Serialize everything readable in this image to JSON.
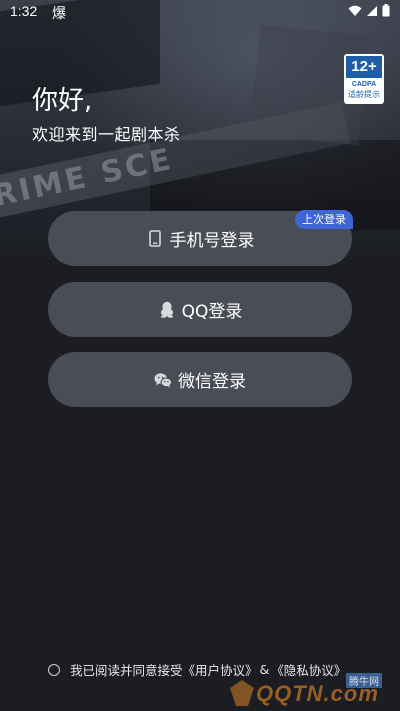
{
  "status_bar": {
    "time": "1:32",
    "carrier_icon_text": "爆"
  },
  "hero": {
    "tape_text": "RIME SCE"
  },
  "age_rating": {
    "number": "12+",
    "org": "CADPA",
    "tip": "适龄提示"
  },
  "greeting": {
    "title": "你好,",
    "subtitle": "欢迎来到一起剧本杀"
  },
  "login": {
    "phone_label": "手机号登录",
    "last_login_badge": "上次登录",
    "qq_label": "QQ登录",
    "wechat_label": "微信登录"
  },
  "agreement": {
    "prefix": "我已阅读并同意接受",
    "user_agreement": "《用户协议》",
    "amp": "&",
    "privacy_policy": "《隐私协议》"
  },
  "watermark": {
    "text": "QQTN.com",
    "site": "腾牛网"
  },
  "colors": {
    "background": "#1b1d23",
    "button": "#4a4d55",
    "badge_blue": "#3f64d6",
    "age_blue": "#1e5fa8"
  }
}
